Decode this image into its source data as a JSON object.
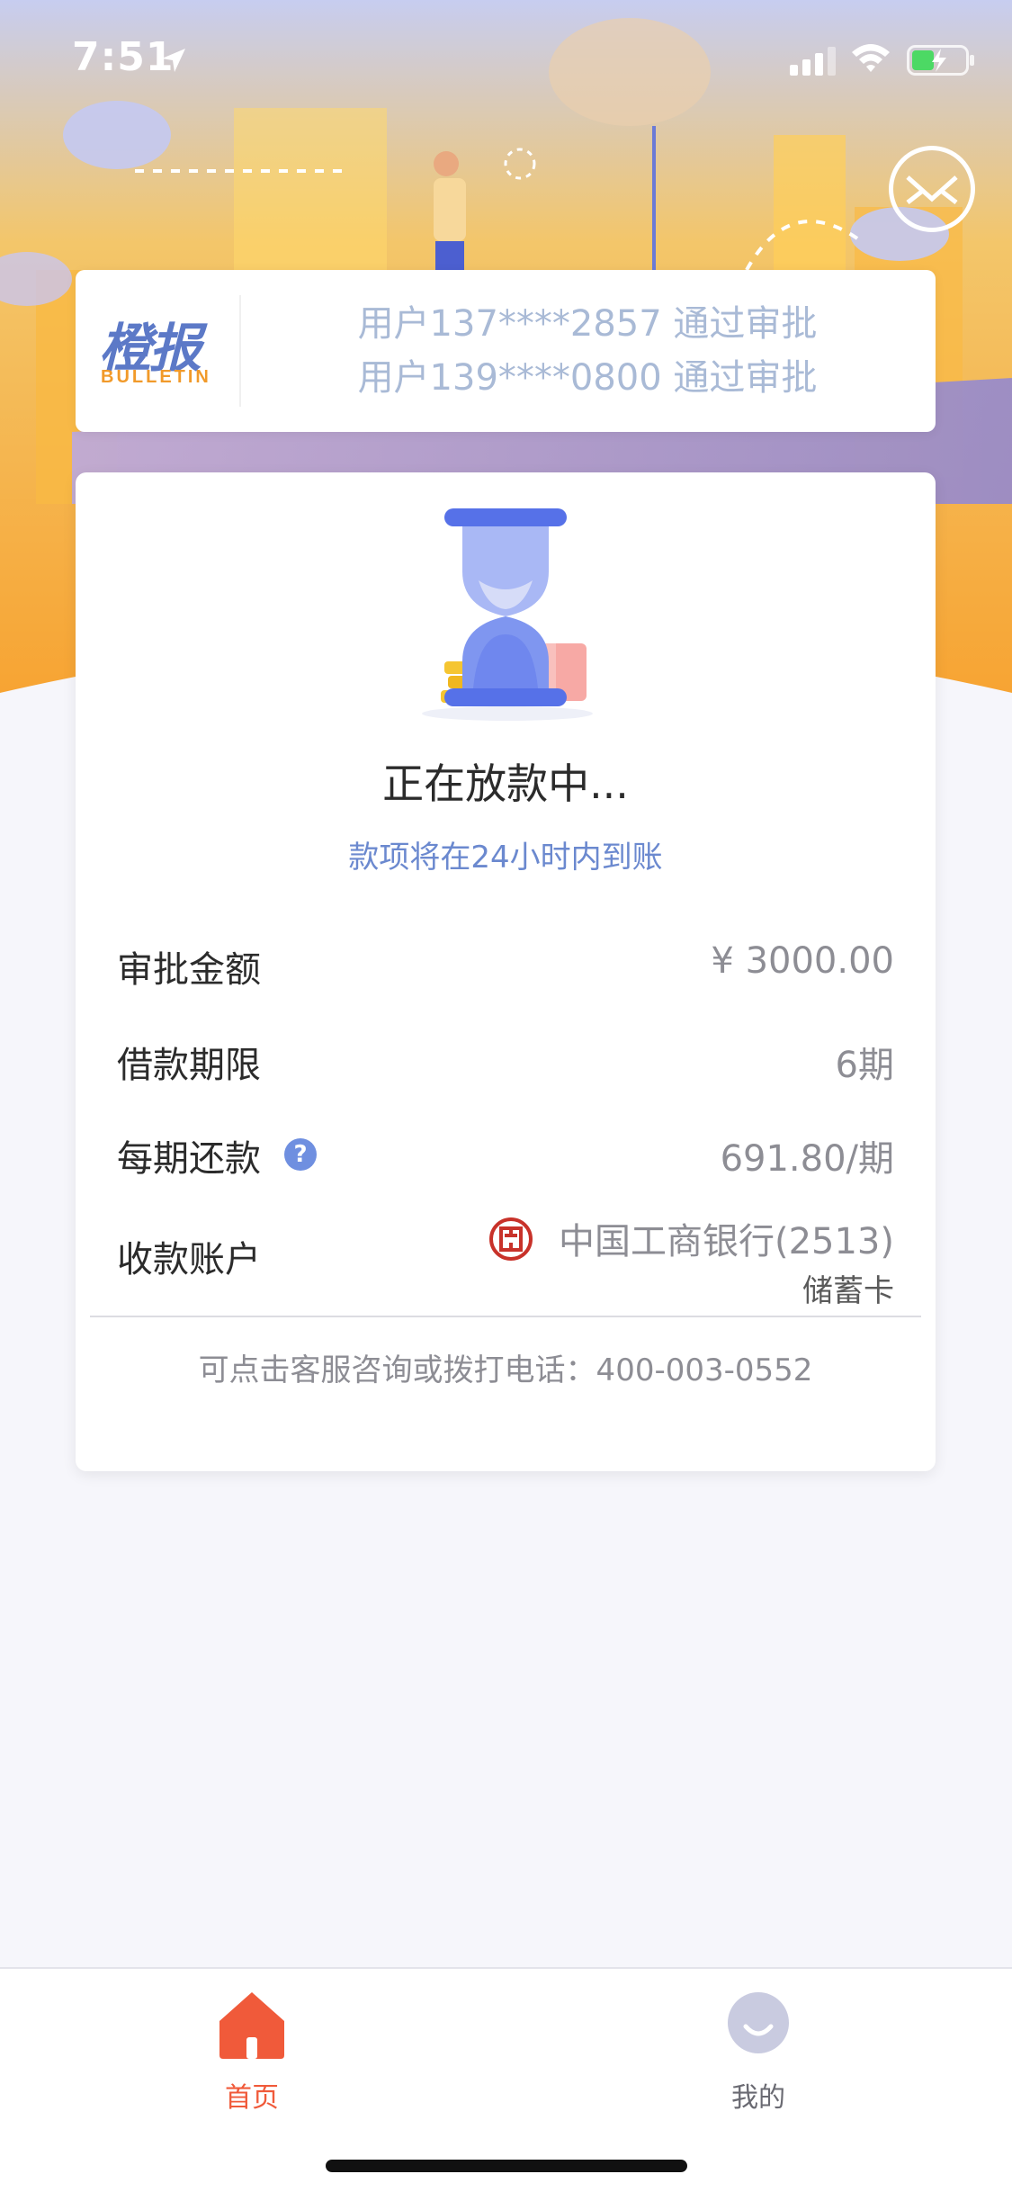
{
  "status_bar": {
    "time": "7:51"
  },
  "bulletin": {
    "logo_cn": "橙报",
    "logo_en": "BULLETIN",
    "lines": [
      "用户137****2857 通过审批",
      "用户139****0800 通过审批"
    ]
  },
  "loan_status": {
    "title": "正在放款中...",
    "subtitle": "款项将在24小时内到账"
  },
  "details": [
    {
      "label": "审批金额",
      "value": "¥ 3000.00"
    },
    {
      "label": "借款期限",
      "value": "6期"
    },
    {
      "label": "每期还款",
      "value": "691.80/期"
    },
    {
      "label": "收款账户",
      "value": "中国工商银行(2513)",
      "sub_value": "储蓄卡"
    }
  ],
  "help_icon_glyph": "?",
  "hotline": "可点击客服咨询或拨打电话：400-003-0552",
  "tabs": [
    {
      "label": "首页",
      "icon": "home-icon",
      "active": true
    },
    {
      "label": "我的",
      "icon": "profile-icon",
      "active": false
    }
  ],
  "colors": {
    "accent": "#f05a3a",
    "brand_blue": "#5c79c7",
    "hero_orange": "#f6a93b"
  }
}
